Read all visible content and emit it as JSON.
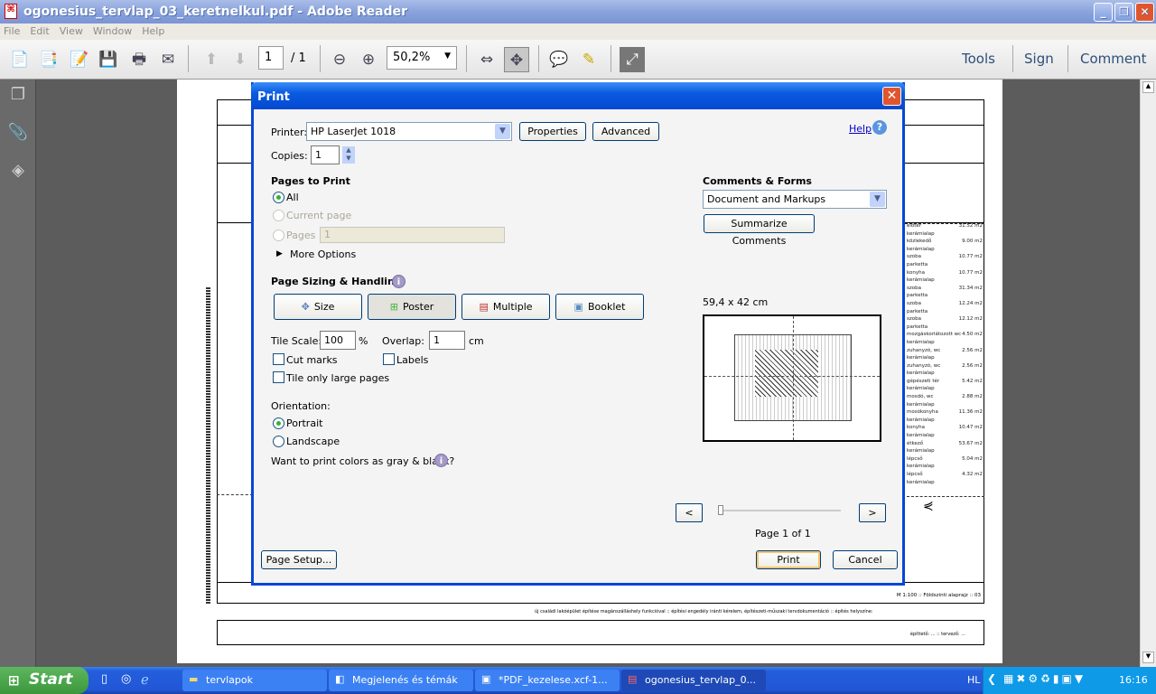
{
  "window": {
    "title": "ogonesius_tervlap_03_keretnelkul.pdf - Adobe Reader"
  },
  "menu": [
    "File",
    "Edit",
    "View",
    "Window",
    "Help"
  ],
  "toolbar": {
    "page_current": "1",
    "page_total": "/ 1",
    "zoom": "50,2%",
    "tools": "Tools",
    "sign": "Sign",
    "comment": "Comment"
  },
  "document": {
    "rooms": [
      {
        "name": "előtér",
        "area": "31.52 m2",
        "floor": "kerámialap"
      },
      {
        "name": "közlekedő",
        "area": "9.00 m2",
        "floor": "kerámialap"
      },
      {
        "name": "szoba",
        "area": "10.77 m2",
        "floor": "parketta"
      },
      {
        "name": "konyha",
        "area": "10.77 m2",
        "floor": "kerámialap"
      },
      {
        "name": "szoba",
        "area": "31.34 m2",
        "floor": "parketta"
      },
      {
        "name": "szoba",
        "area": "12.24 m2",
        "floor": "parketta"
      },
      {
        "name": "szoba",
        "area": "12.12 m2",
        "floor": "parketta"
      },
      {
        "name": "mozgáskorlátozott wc",
        "area": "4.50 m2",
        "floor": "kerámialap"
      },
      {
        "name": "zuhanyzó, wc",
        "area": "2.56 m2",
        "floor": "kerámialap"
      },
      {
        "name": "zuhanyzó, wc",
        "area": "2.56 m2",
        "floor": "kerámialap"
      },
      {
        "name": "gépészeti tér",
        "area": "5.42 m2",
        "floor": "kerámialap"
      },
      {
        "name": "mosdó, wc",
        "area": "2.88 m2",
        "floor": "kerámialap"
      },
      {
        "name": "mosókonyha",
        "area": "11.36 m2",
        "floor": "kerámialap"
      },
      {
        "name": "konyha",
        "area": "10.47 m2",
        "floor": "kerámialap"
      },
      {
        "name": "étkező",
        "area": "53.67 m2",
        "floor": "kerámialap"
      },
      {
        "name": "lépcső",
        "area": "5.04 m2",
        "floor": "kerámialap"
      },
      {
        "name": "lépcső",
        "area": "4.32 m2",
        "floor": "kerámialap"
      }
    ],
    "sheet_title": "M 1:100 :: Földszinti alaprajz :: 03",
    "project_line": "új családi lakóépület építése magánszálláshely funkcióval :: építési engedély iránti kérelem, építészeti-műszaki tervdokumentáció :: építés helyszíne:",
    "people_line": "építtető: ... :: tervező: ..."
  },
  "dialog": {
    "title": "Print",
    "printer_label": "Printer:",
    "printer": "HP LaserJet 1018",
    "properties": "Properties",
    "advanced": "Advanced",
    "help": "Help",
    "copies_label": "Copies:",
    "copies": "1",
    "pages_heading": "Pages to Print",
    "pages_options": [
      {
        "label": "All",
        "selected": true,
        "enabled": true
      },
      {
        "label": "Current page",
        "selected": false,
        "enabled": false
      },
      {
        "label": "Pages",
        "selected": false,
        "enabled": false
      }
    ],
    "pages_value": "1",
    "more_options": "More Options",
    "sizing_heading": "Page Sizing & Handling",
    "sizing_buttons": [
      {
        "label": "Size",
        "selected": false
      },
      {
        "label": "Poster",
        "selected": true
      },
      {
        "label": "Multiple",
        "selected": false
      },
      {
        "label": "Booklet",
        "selected": false
      }
    ],
    "tile_scale_label": "Tile Scale:",
    "tile_scale": "100",
    "percent": "%",
    "overlap_label": "Overlap:",
    "overlap": "1",
    "cm": "cm",
    "cut_marks": "Cut marks",
    "labels": "Labels",
    "tile_large": "Tile only large pages",
    "orientation_label": "Orientation:",
    "portrait": "Portrait",
    "landscape": "Landscape",
    "orientation": "Portrait",
    "gray_question": "Want to print colors as gray & black?",
    "comments_heading": "Comments & Forms",
    "comments_value": "Document and Markups",
    "summarize": "Summarize Comments",
    "preview_size": "59,4 x 42 cm",
    "page_of": "Page 1 of 1",
    "prev": "<",
    "next": ">",
    "page_setup": "Page Setup...",
    "print": "Print",
    "cancel": "Cancel"
  },
  "taskbar": {
    "start": "Start",
    "tasks": [
      {
        "label": "tervlapok",
        "active": false
      },
      {
        "label": "Megjelenés és témák",
        "active": false
      },
      {
        "label": "*PDF_kezelese.xcf-1...",
        "active": false
      },
      {
        "label": "ogonesius_tervlap_0...",
        "active": true
      }
    ],
    "lang": "HL",
    "clock": "16:16"
  },
  "colors": {
    "titlebar": "#0a5be0",
    "taskbar": "#245edb",
    "start": "#3c973c",
    "dialog_bg": "#f4f4f4"
  }
}
